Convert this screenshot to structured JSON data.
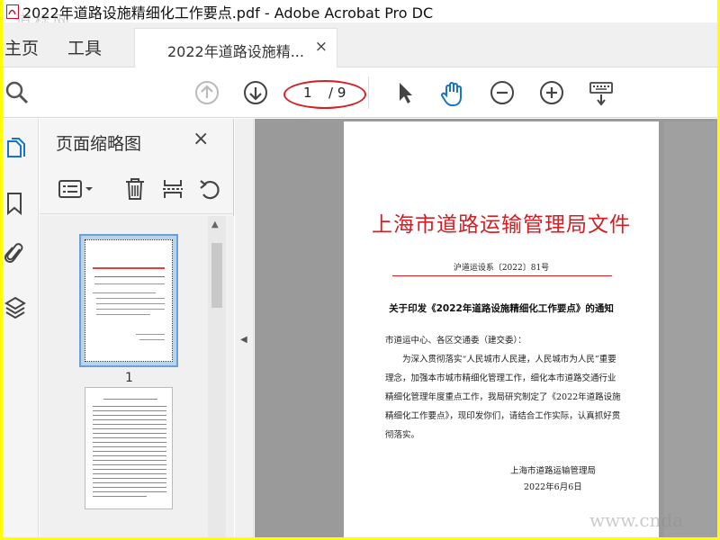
{
  "window": {
    "title": "2022年道路设施精细化工作要点.pdf - Adobe Acrobat Pro DC",
    "watermark_top": "道标网",
    "watermark_bottom": "www.cnda"
  },
  "tabs": {
    "home": "主页",
    "tools": "工具",
    "document": "2022年道路设施精...",
    "close": "×"
  },
  "toolbar": {
    "page_current": "1",
    "page_total": "/ 9",
    "icons": [
      "search-icon",
      "prev-page-icon",
      "next-page-icon",
      "select-pointer-icon",
      "hand-tool-icon",
      "zoom-out-icon",
      "zoom-in-icon",
      "keyboard-scroll-icon"
    ]
  },
  "sidebar": {
    "rail_icons": [
      "page-thumbnails-icon",
      "bookmark-icon",
      "attachment-icon",
      "layers-icon"
    ],
    "pane_title": "页面缩略图",
    "pane_close": "×",
    "thumbnail_label": "1",
    "tools": [
      "options-menu-icon",
      "delete-icon",
      "insert-pages-icon",
      "rotate-icon"
    ]
  },
  "document": {
    "header": "上海市道路运输管理局文件",
    "number": "沪道运设系〔2022〕81号",
    "subject": "关于印发《2022年道路设施精细化工作要点》的通知",
    "recipients": "市道运中心、各区交通委（建交委）：",
    "body": "为深入贯彻落实“人民城市人民建，人民城市为人民”重要理念，加强本市城市精细化管理工作，细化本市道路交通行业精细化管理年度重点工作，我局研究制定了《2022年道路设施精细化工作要点》，现印发你们，请结合工作实际，认真抓好贯彻落实。",
    "signature": "上海市道路运输管理局",
    "date": "2022年6月6日"
  },
  "colors": {
    "accent_blue": "#1a73c8",
    "annotation_red": "#d61f26",
    "doc_header_red": "#d41e24",
    "frame_yellow": "#ffff00"
  }
}
